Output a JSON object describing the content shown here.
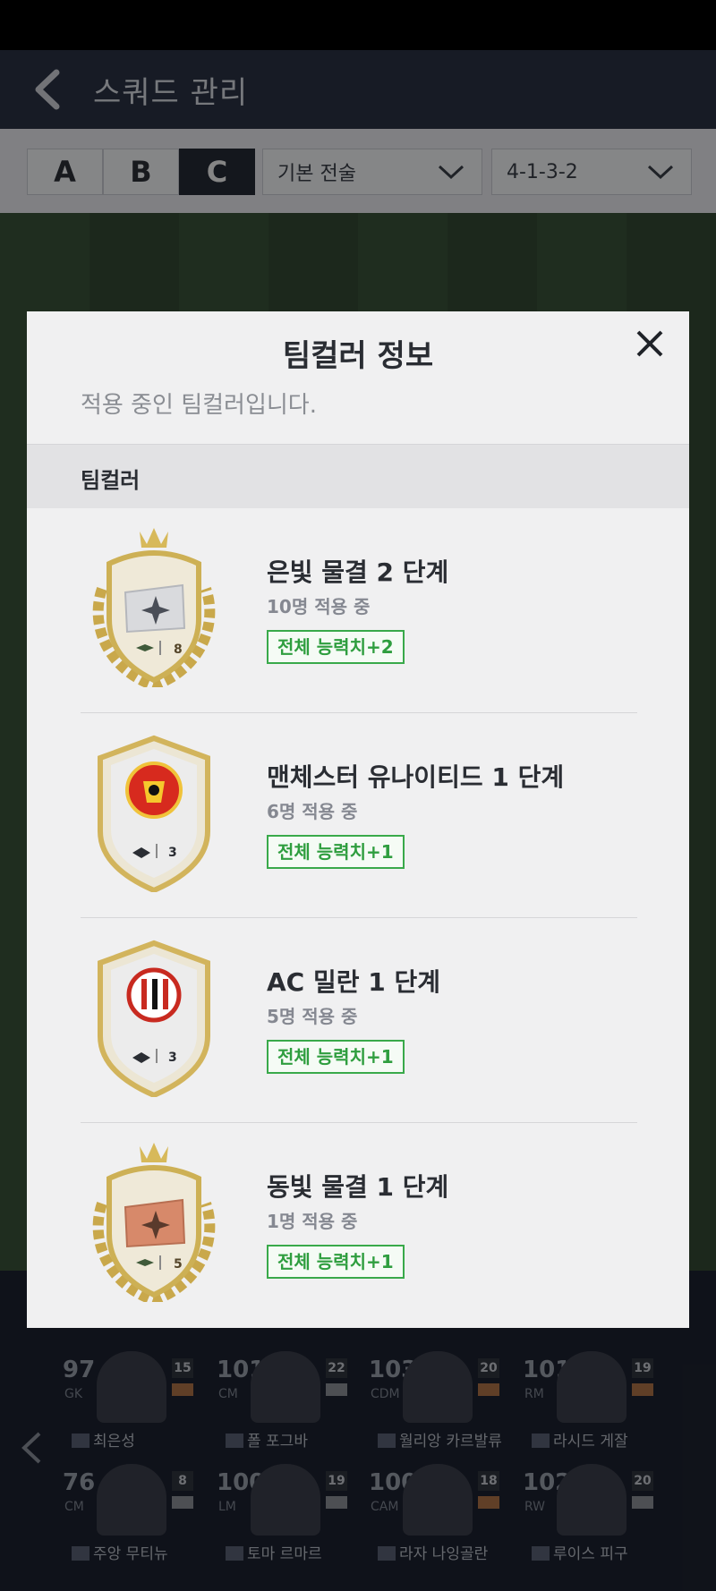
{
  "header": {
    "title": "스쿼드 관리"
  },
  "squad_tabs": [
    "A",
    "B",
    "C"
  ],
  "active_tab": "C",
  "tactic_select": {
    "value": "기본 전술"
  },
  "formation_select": {
    "value": "4-1-3-2"
  },
  "players": [
    {
      "ovr": "97",
      "pos": "GK",
      "level": "15",
      "grade": "bronze",
      "name": "최은성"
    },
    {
      "ovr": "101",
      "pos": "CM",
      "level": "22",
      "grade": "silver",
      "name": "폴 포그바"
    },
    {
      "ovr": "103",
      "pos": "CDM",
      "level": "20",
      "grade": "bronze",
      "name": "월리앙 카르발류"
    },
    {
      "ovr": "101",
      "pos": "RM",
      "level": "19",
      "grade": "bronze",
      "name": "라시드 게잘"
    },
    {
      "ovr": "76",
      "pos": "CM",
      "level": "8",
      "grade": "silver",
      "name": "주앙 무티뉴"
    },
    {
      "ovr": "100",
      "pos": "LM",
      "level": "19",
      "grade": "silver",
      "name": "토마 르마르"
    },
    {
      "ovr": "100",
      "pos": "CAM",
      "level": "18",
      "grade": "bronze",
      "name": "라자 나잉골란"
    },
    {
      "ovr": "102",
      "pos": "RW",
      "level": "20",
      "grade": "silver",
      "name": "루이스 피구"
    }
  ],
  "modal": {
    "title": "팀컬러 정보",
    "subtitle": "적용 중인 팀컬러입니다.",
    "section_label": "팀컬러",
    "items": [
      {
        "name": "은빛 물결 2 단계",
        "count": "10명 적용 중",
        "effect": "전체 능력치+2",
        "badge_type": "wreath-silver",
        "badge_number": "8"
      },
      {
        "name": "맨체스터 유나이티드 1 단계",
        "count": "6명 적용 중",
        "effect": "전체 능력치+1",
        "badge_type": "club-man-utd",
        "badge_number": "3"
      },
      {
        "name": "AC 밀란 1 단계",
        "count": "5명 적용 중",
        "effect": "전체 능력치+1",
        "badge_type": "club-ac-milan",
        "badge_number": "3"
      },
      {
        "name": "동빛 물결 1 단계",
        "count": "1명 적용 중",
        "effect": "전체 능력치+1",
        "badge_type": "wreath-bronze",
        "badge_number": "5"
      }
    ]
  },
  "colors": {
    "accent_green": "#39a94a",
    "header_bg": "#2b3244",
    "active_tab": "#252a36"
  }
}
